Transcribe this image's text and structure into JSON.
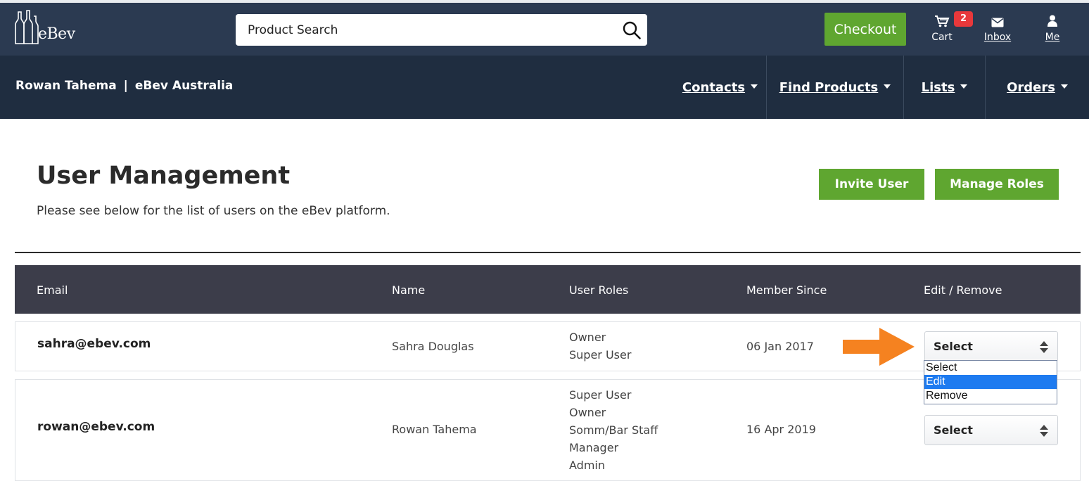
{
  "brand": {
    "name": "eBev"
  },
  "search": {
    "placeholder": "Product Search"
  },
  "header_actions": {
    "checkout_label": "Checkout",
    "cart_label": "Cart",
    "cart_count": "2",
    "inbox_label": "Inbox",
    "me_label": "Me"
  },
  "account": {
    "user": "Rowan Tahema",
    "separator": "|",
    "company": "eBev Australia"
  },
  "nav": {
    "items": [
      {
        "label": "Contacts"
      },
      {
        "label": "Find Products"
      },
      {
        "label": "Lists"
      },
      {
        "label": "Orders"
      }
    ]
  },
  "page": {
    "title": "User Management",
    "subtitle": "Please see below for the list of users on the eBev platform.",
    "invite_label": "Invite User",
    "manage_roles_label": "Manage Roles"
  },
  "table": {
    "headers": [
      "Email",
      "Name",
      "User Roles",
      "Member Since",
      "Edit / Remove"
    ],
    "rows": [
      {
        "email": "sahra@ebev.com",
        "name": "Sahra Douglas",
        "roles": [
          "Owner",
          "Super User"
        ],
        "member_since": "06 Jan 2017",
        "action_value": "Select"
      },
      {
        "email": "rowan@ebev.com",
        "name": "Rowan Tahema",
        "roles": [
          "Super User",
          "Owner",
          "Somm/Bar Staff",
          "Manager",
          "Admin"
        ],
        "member_since": "16 Apr 2019",
        "action_value": "Select"
      }
    ]
  },
  "dropdown": {
    "options": [
      "Select",
      "Edit",
      "Remove"
    ],
    "highlighted": "Edit"
  },
  "colors": {
    "topbar": "#2b3a51",
    "subbar": "#1f2d40",
    "accent_green": "#5fa630",
    "badge_red": "#e8383b",
    "table_header": "#3c3d4a",
    "annotation_arrow": "#f58220",
    "option_highlight": "#1e7bf0"
  }
}
